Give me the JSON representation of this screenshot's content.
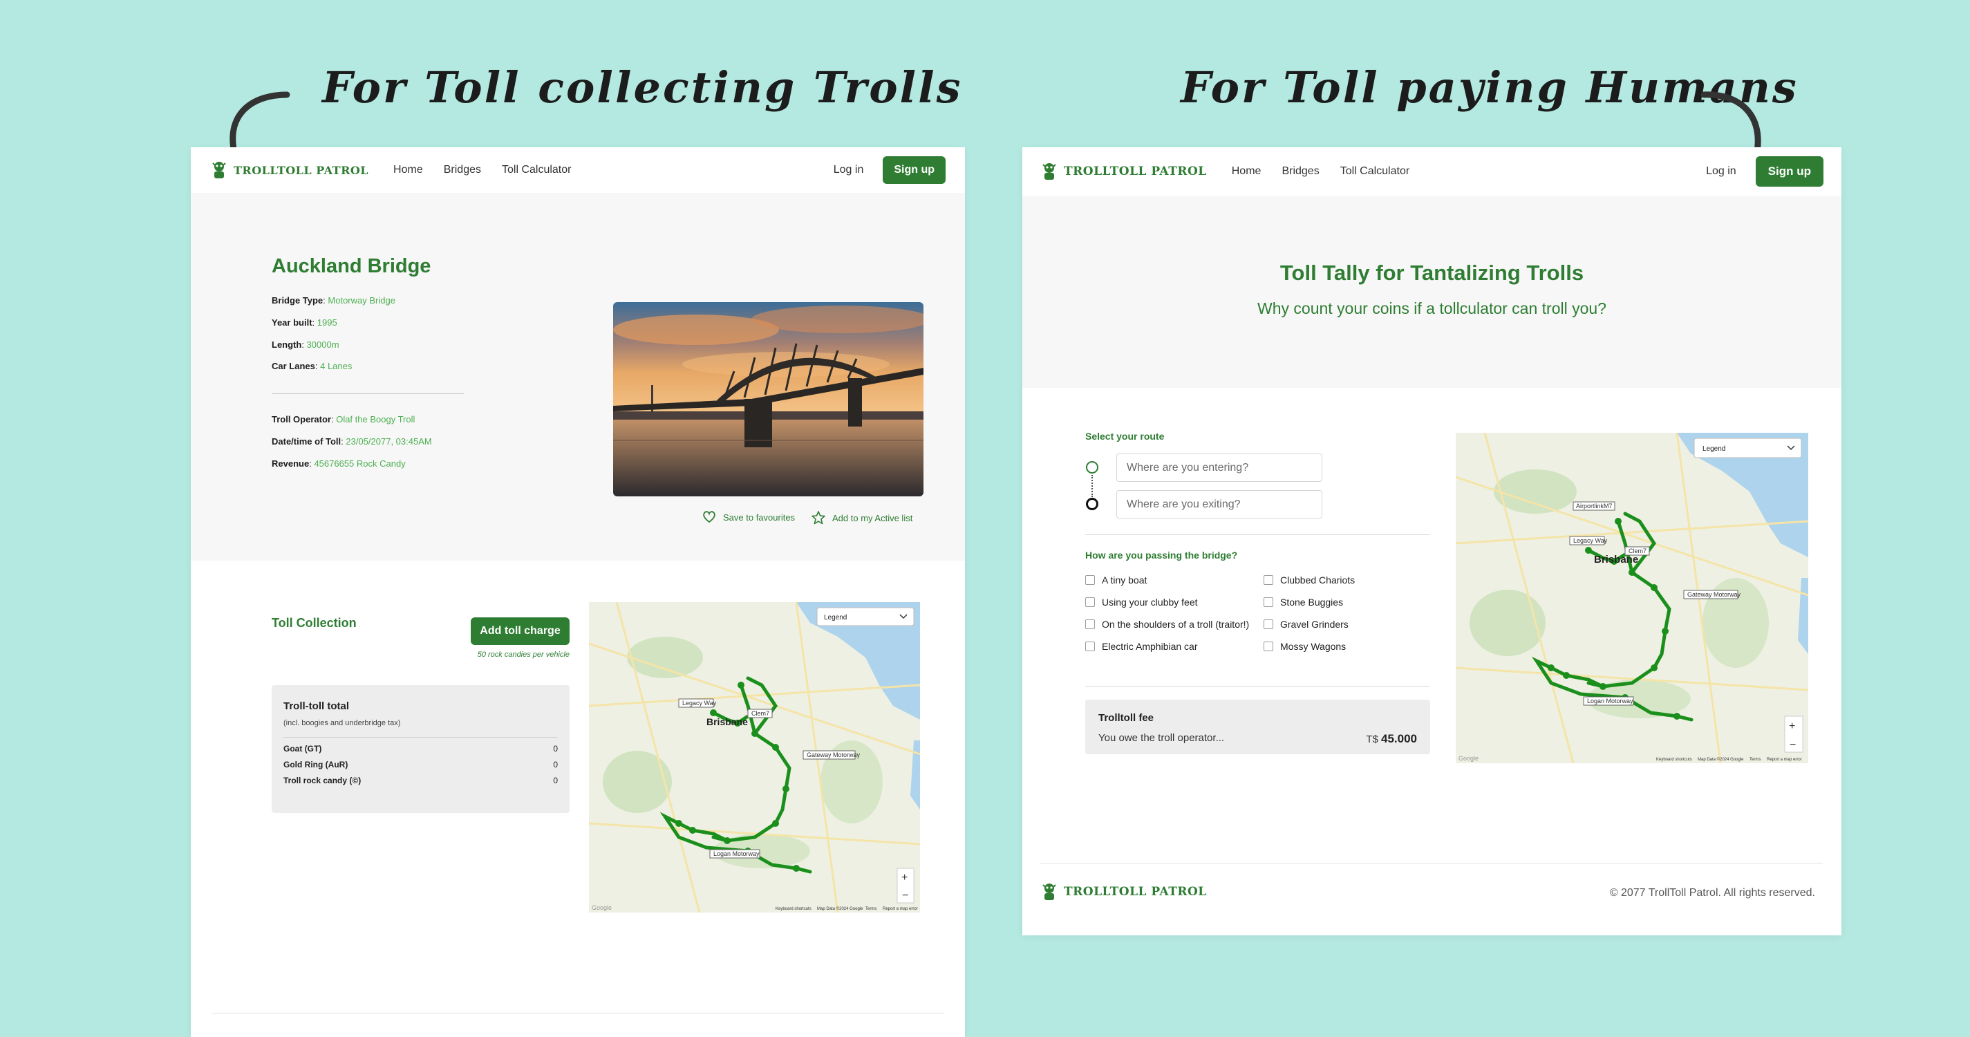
{
  "annotations": {
    "left_caption": "For Toll collecting Trolls",
    "right_caption": "For Toll paying Humans"
  },
  "brand": {
    "name": "TrollToll Patrol",
    "green": "#2e7d32",
    "bg": "#b3e9e1"
  },
  "nav": {
    "links": [
      "Home",
      "Bridges",
      "Toll Calculator"
    ],
    "login": "Log in",
    "signup": "Sign up"
  },
  "bridge": {
    "title": "Auckland Bridge",
    "type_label": "Bridge Type",
    "type_value": "Motorway Bridge",
    "year_label": "Year built",
    "year_value": "1995",
    "length_label": "Length",
    "length_value": "30000m",
    "lanes_label": "Car Lanes",
    "lanes_value": "4 Lanes",
    "operator_label": "Troll Operator",
    "operator_value": "Olaf the Boogy Troll",
    "datetime_label": "Date/time of Toll",
    "datetime_value": "23/05/2077, 03:45AM",
    "revenue_label": "Revenue",
    "revenue_value": "45676655 Rock Candy",
    "save_favourites": "Save to favourites",
    "add_active": "Add to my Active list"
  },
  "toll": {
    "title": "Toll Collection",
    "add_button": "Add toll charge",
    "note": "50 rock candies per vehicle",
    "total_title": "Troll-toll total",
    "total_sub": "(incl. boogies and underbridge tax)",
    "rows": [
      {
        "label": "Goat (GT)",
        "value": "0"
      },
      {
        "label": "Gold Ring (AuR)",
        "value": "0"
      },
      {
        "label": "Troll rock candy (©)",
        "value": "0"
      }
    ]
  },
  "map": {
    "legend": "Legend",
    "city": "Brisbane",
    "roads": [
      "Legacy Way",
      "Clem7",
      "Gateway Motorway",
      "Logan Motorway",
      "AirportlinkM7"
    ],
    "roads_left": [
      "Legacy Way",
      "Clem7",
      "Gateway Motorway",
      "Logan Motorway"
    ],
    "zoom_in": "+",
    "zoom_out": "−",
    "footer_left": "Keyboard shortcuts",
    "footer_mid": "Map Data ©2024 Google",
    "footer_terms": "Terms",
    "footer_report": "Report a map error",
    "google": "Google"
  },
  "calculator": {
    "title": "Toll Tally for Tantalizing Trolls",
    "subtitle": "Why count your coins if a tollculator can troll you?",
    "route_label": "Select your route",
    "entry_placeholder": "Where are you entering?",
    "exit_placeholder": "Where are you exiting?",
    "passing_label": "How are you passing the bridge?",
    "options_col1": [
      "A tiny boat",
      "Using your clubby feet",
      "On the shoulders of a troll (traitor!)",
      "Electric Amphibian car"
    ],
    "options_col2": [
      "Clubbed Chariots",
      "Stone Buggies",
      "Gravel Grinders",
      "Mossy Wagons"
    ],
    "fee_title": "Trolltoll fee",
    "fee_text": "You owe the troll operator...",
    "fee_currency": "T$",
    "fee_amount": "45.000"
  },
  "footer": {
    "copyright": "© 2077 TrollToll Patrol. All rights reserved."
  }
}
